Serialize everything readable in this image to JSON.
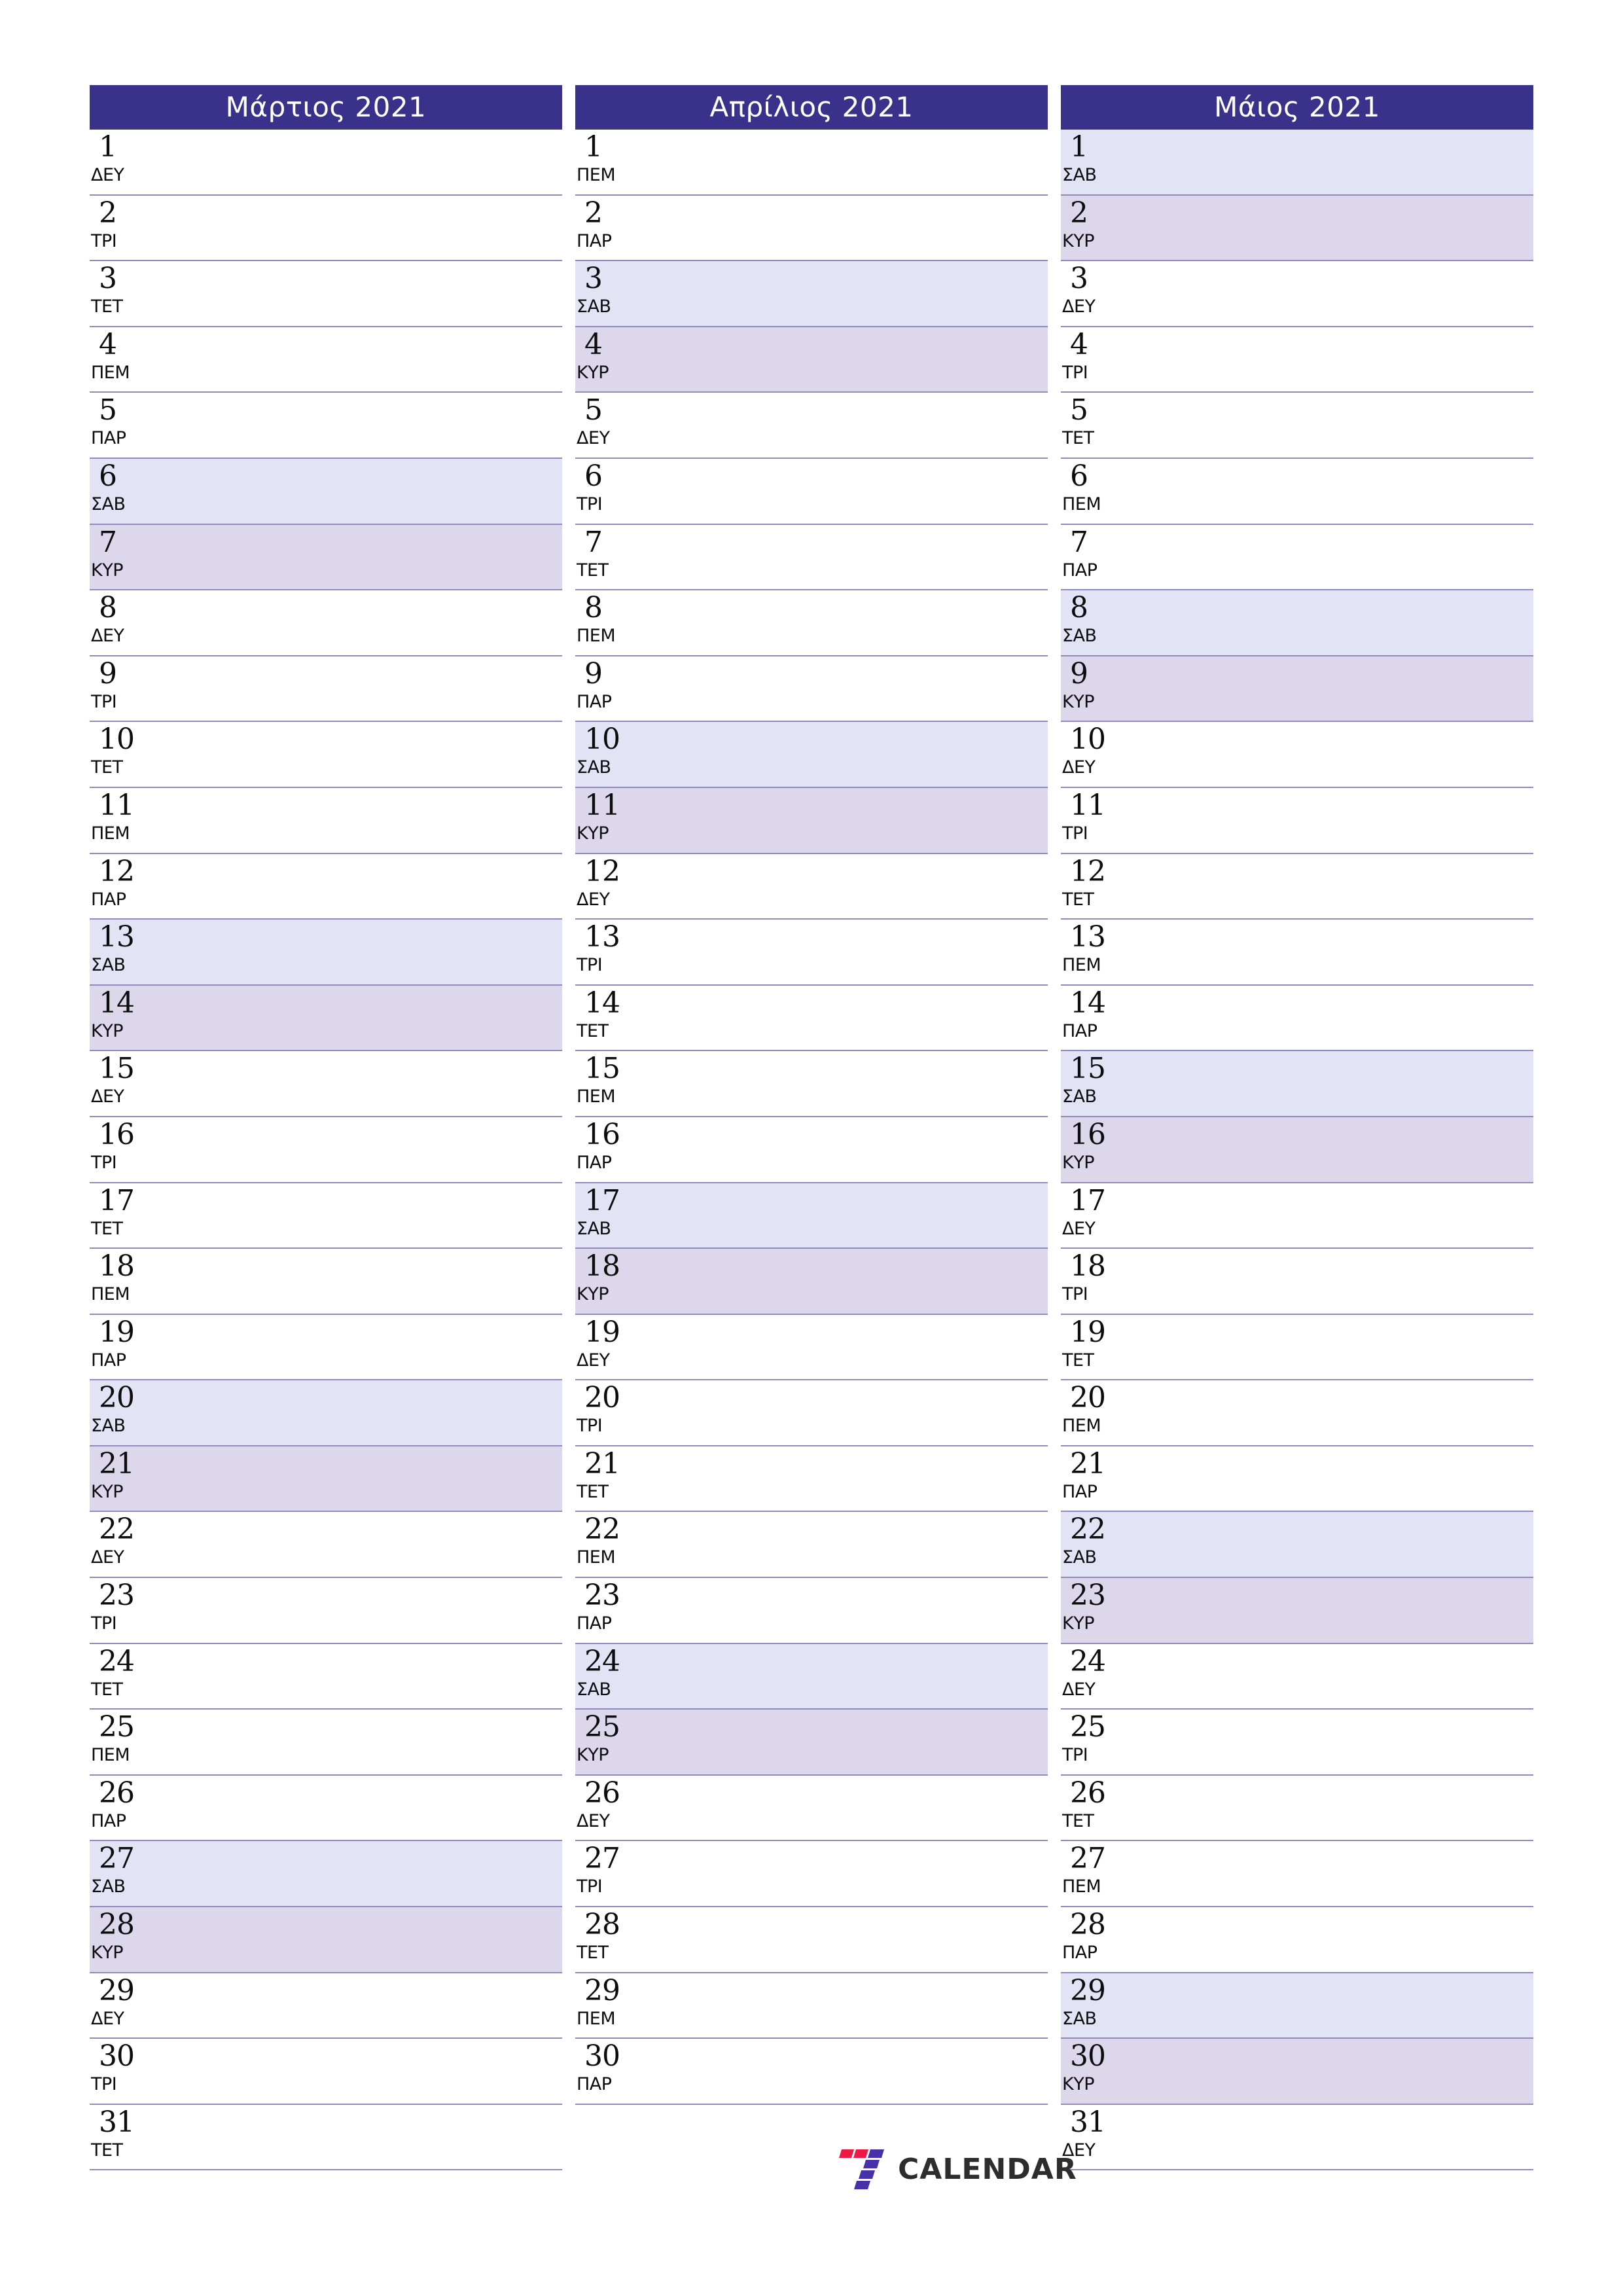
{
  "document": {
    "type": "calendar-planner",
    "year": "2021",
    "locale": "el"
  },
  "theme": {
    "header_bg": "#3a328a",
    "header_text": "#ffffff",
    "saturday_bg": "#e3e3f6",
    "sunday_bg": "#dcd7ea",
    "row_divider": "#8e8abf",
    "page_bg": "#ffffff",
    "day_text": "#0d0d0d"
  },
  "months": [
    {
      "title": "Μάρτιος 2021",
      "name": "Μάρτιος",
      "days": [
        {
          "num": "1",
          "dow": "ΔΕΥ",
          "type": "weekday"
        },
        {
          "num": "2",
          "dow": "ΤΡΙ",
          "type": "weekday"
        },
        {
          "num": "3",
          "dow": "ΤΕΤ",
          "type": "weekday"
        },
        {
          "num": "4",
          "dow": "ΠΕΜ",
          "type": "weekday"
        },
        {
          "num": "5",
          "dow": "ΠΑΡ",
          "type": "weekday"
        },
        {
          "num": "6",
          "dow": "ΣΑΒ",
          "type": "sat"
        },
        {
          "num": "7",
          "dow": "ΚΥΡ",
          "type": "sun"
        },
        {
          "num": "8",
          "dow": "ΔΕΥ",
          "type": "weekday"
        },
        {
          "num": "9",
          "dow": "ΤΡΙ",
          "type": "weekday"
        },
        {
          "num": "10",
          "dow": "ΤΕΤ",
          "type": "weekday"
        },
        {
          "num": "11",
          "dow": "ΠΕΜ",
          "type": "weekday"
        },
        {
          "num": "12",
          "dow": "ΠΑΡ",
          "type": "weekday"
        },
        {
          "num": "13",
          "dow": "ΣΑΒ",
          "type": "sat"
        },
        {
          "num": "14",
          "dow": "ΚΥΡ",
          "type": "sun"
        },
        {
          "num": "15",
          "dow": "ΔΕΥ",
          "type": "weekday"
        },
        {
          "num": "16",
          "dow": "ΤΡΙ",
          "type": "weekday"
        },
        {
          "num": "17",
          "dow": "ΤΕΤ",
          "type": "weekday"
        },
        {
          "num": "18",
          "dow": "ΠΕΜ",
          "type": "weekday"
        },
        {
          "num": "19",
          "dow": "ΠΑΡ",
          "type": "weekday"
        },
        {
          "num": "20",
          "dow": "ΣΑΒ",
          "type": "sat"
        },
        {
          "num": "21",
          "dow": "ΚΥΡ",
          "type": "sun"
        },
        {
          "num": "22",
          "dow": "ΔΕΥ",
          "type": "weekday"
        },
        {
          "num": "23",
          "dow": "ΤΡΙ",
          "type": "weekday"
        },
        {
          "num": "24",
          "dow": "ΤΕΤ",
          "type": "weekday"
        },
        {
          "num": "25",
          "dow": "ΠΕΜ",
          "type": "weekday"
        },
        {
          "num": "26",
          "dow": "ΠΑΡ",
          "type": "weekday"
        },
        {
          "num": "27",
          "dow": "ΣΑΒ",
          "type": "sat"
        },
        {
          "num": "28",
          "dow": "ΚΥΡ",
          "type": "sun"
        },
        {
          "num": "29",
          "dow": "ΔΕΥ",
          "type": "weekday"
        },
        {
          "num": "30",
          "dow": "ΤΡΙ",
          "type": "weekday"
        },
        {
          "num": "31",
          "dow": "ΤΕΤ",
          "type": "weekday"
        }
      ]
    },
    {
      "title": "Απρίλιος 2021",
      "name": "Απρίλιος",
      "days": [
        {
          "num": "1",
          "dow": "ΠΕΜ",
          "type": "weekday"
        },
        {
          "num": "2",
          "dow": "ΠΑΡ",
          "type": "weekday"
        },
        {
          "num": "3",
          "dow": "ΣΑΒ",
          "type": "sat"
        },
        {
          "num": "4",
          "dow": "ΚΥΡ",
          "type": "sun"
        },
        {
          "num": "5",
          "dow": "ΔΕΥ",
          "type": "weekday"
        },
        {
          "num": "6",
          "dow": "ΤΡΙ",
          "type": "weekday"
        },
        {
          "num": "7",
          "dow": "ΤΕΤ",
          "type": "weekday"
        },
        {
          "num": "8",
          "dow": "ΠΕΜ",
          "type": "weekday"
        },
        {
          "num": "9",
          "dow": "ΠΑΡ",
          "type": "weekday"
        },
        {
          "num": "10",
          "dow": "ΣΑΒ",
          "type": "sat"
        },
        {
          "num": "11",
          "dow": "ΚΥΡ",
          "type": "sun"
        },
        {
          "num": "12",
          "dow": "ΔΕΥ",
          "type": "weekday"
        },
        {
          "num": "13",
          "dow": "ΤΡΙ",
          "type": "weekday"
        },
        {
          "num": "14",
          "dow": "ΤΕΤ",
          "type": "weekday"
        },
        {
          "num": "15",
          "dow": "ΠΕΜ",
          "type": "weekday"
        },
        {
          "num": "16",
          "dow": "ΠΑΡ",
          "type": "weekday"
        },
        {
          "num": "17",
          "dow": "ΣΑΒ",
          "type": "sat"
        },
        {
          "num": "18",
          "dow": "ΚΥΡ",
          "type": "sun"
        },
        {
          "num": "19",
          "dow": "ΔΕΥ",
          "type": "weekday"
        },
        {
          "num": "20",
          "dow": "ΤΡΙ",
          "type": "weekday"
        },
        {
          "num": "21",
          "dow": "ΤΕΤ",
          "type": "weekday"
        },
        {
          "num": "22",
          "dow": "ΠΕΜ",
          "type": "weekday"
        },
        {
          "num": "23",
          "dow": "ΠΑΡ",
          "type": "weekday"
        },
        {
          "num": "24",
          "dow": "ΣΑΒ",
          "type": "sat"
        },
        {
          "num": "25",
          "dow": "ΚΥΡ",
          "type": "sun"
        },
        {
          "num": "26",
          "dow": "ΔΕΥ",
          "type": "weekday"
        },
        {
          "num": "27",
          "dow": "ΤΡΙ",
          "type": "weekday"
        },
        {
          "num": "28",
          "dow": "ΤΕΤ",
          "type": "weekday"
        },
        {
          "num": "29",
          "dow": "ΠΕΜ",
          "type": "weekday"
        },
        {
          "num": "30",
          "dow": "ΠΑΡ",
          "type": "weekday"
        }
      ]
    },
    {
      "title": "Μάιος 2021",
      "name": "Μάιος",
      "days": [
        {
          "num": "1",
          "dow": "ΣΑΒ",
          "type": "sat"
        },
        {
          "num": "2",
          "dow": "ΚΥΡ",
          "type": "sun"
        },
        {
          "num": "3",
          "dow": "ΔΕΥ",
          "type": "weekday"
        },
        {
          "num": "4",
          "dow": "ΤΡΙ",
          "type": "weekday"
        },
        {
          "num": "5",
          "dow": "ΤΕΤ",
          "type": "weekday"
        },
        {
          "num": "6",
          "dow": "ΠΕΜ",
          "type": "weekday"
        },
        {
          "num": "7",
          "dow": "ΠΑΡ",
          "type": "weekday"
        },
        {
          "num": "8",
          "dow": "ΣΑΒ",
          "type": "sat"
        },
        {
          "num": "9",
          "dow": "ΚΥΡ",
          "type": "sun"
        },
        {
          "num": "10",
          "dow": "ΔΕΥ",
          "type": "weekday"
        },
        {
          "num": "11",
          "dow": "ΤΡΙ",
          "type": "weekday"
        },
        {
          "num": "12",
          "dow": "ΤΕΤ",
          "type": "weekday"
        },
        {
          "num": "13",
          "dow": "ΠΕΜ",
          "type": "weekday"
        },
        {
          "num": "14",
          "dow": "ΠΑΡ",
          "type": "weekday"
        },
        {
          "num": "15",
          "dow": "ΣΑΒ",
          "type": "sat"
        },
        {
          "num": "16",
          "dow": "ΚΥΡ",
          "type": "sun"
        },
        {
          "num": "17",
          "dow": "ΔΕΥ",
          "type": "weekday"
        },
        {
          "num": "18",
          "dow": "ΤΡΙ",
          "type": "weekday"
        },
        {
          "num": "19",
          "dow": "ΤΕΤ",
          "type": "weekday"
        },
        {
          "num": "20",
          "dow": "ΠΕΜ",
          "type": "weekday"
        },
        {
          "num": "21",
          "dow": "ΠΑΡ",
          "type": "weekday"
        },
        {
          "num": "22",
          "dow": "ΣΑΒ",
          "type": "sat"
        },
        {
          "num": "23",
          "dow": "ΚΥΡ",
          "type": "sun"
        },
        {
          "num": "24",
          "dow": "ΔΕΥ",
          "type": "weekday"
        },
        {
          "num": "25",
          "dow": "ΤΡΙ",
          "type": "weekday"
        },
        {
          "num": "26",
          "dow": "ΤΕΤ",
          "type": "weekday"
        },
        {
          "num": "27",
          "dow": "ΠΕΜ",
          "type": "weekday"
        },
        {
          "num": "28",
          "dow": "ΠΑΡ",
          "type": "weekday"
        },
        {
          "num": "29",
          "dow": "ΣΑΒ",
          "type": "sat"
        },
        {
          "num": "30",
          "dow": "ΚΥΡ",
          "type": "sun"
        },
        {
          "num": "31",
          "dow": "ΔΕΥ",
          "type": "weekday"
        }
      ]
    }
  ],
  "footer": {
    "logo_text": "CALENDAR",
    "logo_mark": "seven-logo-icon",
    "logo_colors": {
      "red": "#ed1944",
      "purple": "#4631a8"
    }
  }
}
